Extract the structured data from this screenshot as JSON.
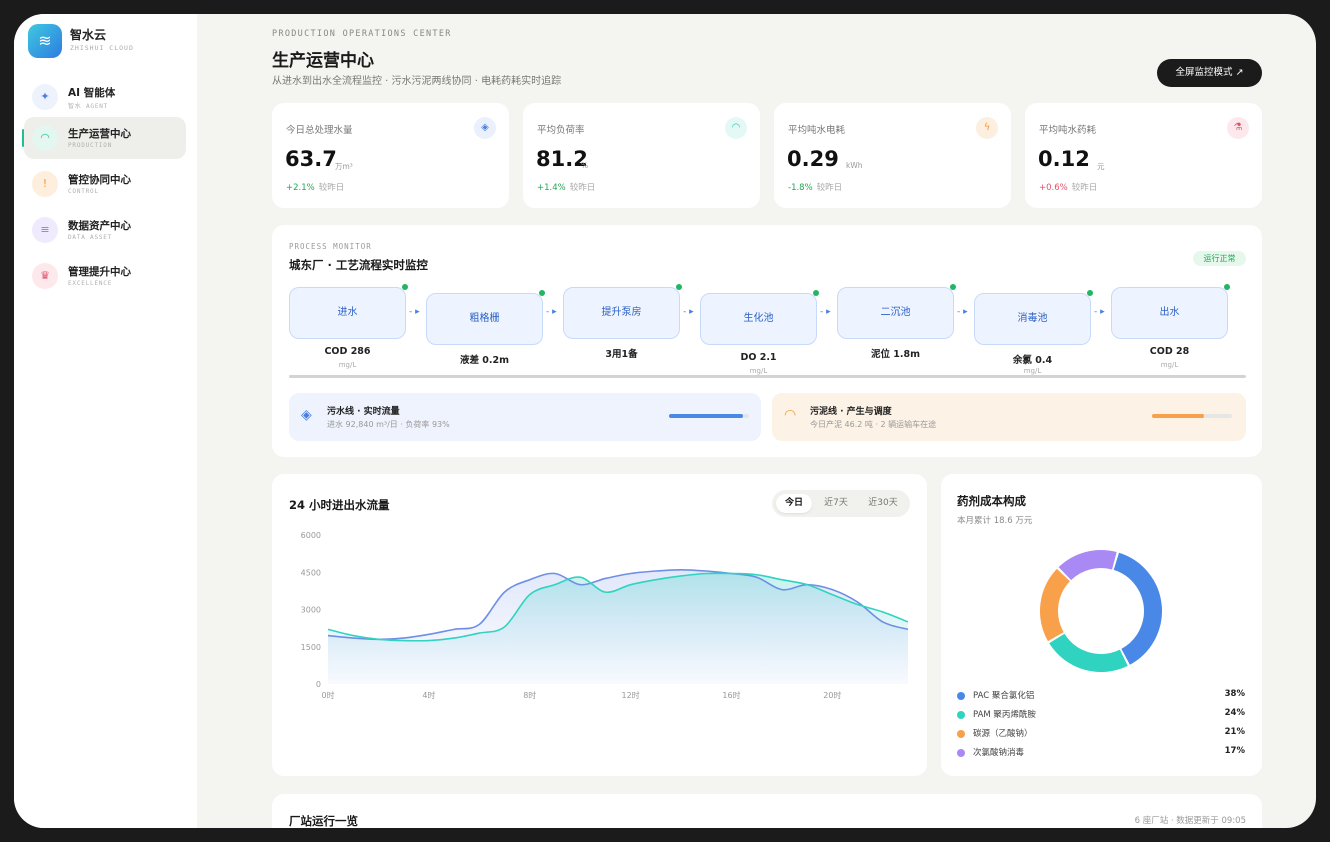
{
  "brand": {
    "name": "智水云",
    "sub": "ZHISHUI CLOUD"
  },
  "nav": [
    {
      "title": "AI 智能体",
      "sub": "智水 AGENT",
      "icon": "sparkle-icon",
      "glyph": "✦",
      "bg": "#eef2fd",
      "color": "#4a7fe0"
    },
    {
      "title": "生产运营中心",
      "sub": "PRODUCTION",
      "icon": "gauge-icon",
      "glyph": "◠",
      "bg": "#e4f6f0",
      "color": "#1fbf8f",
      "active": true
    },
    {
      "title": "管控协同中心",
      "sub": "CONTROL",
      "icon": "shield-icon",
      "glyph": "!",
      "bg": "#fdeedd",
      "color": "#f29a3d"
    },
    {
      "title": "数据资产中心",
      "sub": "DATA ASSET",
      "icon": "database-icon",
      "glyph": "≡",
      "bg": "#efeafd",
      "color": "#9b6ff0"
    },
    {
      "title": "管理提升中心",
      "sub": "EXCELLENCE",
      "icon": "trophy-icon",
      "glyph": "♛",
      "bg": "#fde8ec",
      "color": "#e4506a"
    }
  ],
  "header": {
    "overline": "PRODUCTION OPERATIONS CENTER",
    "title": "生产运营中心",
    "subtitle": "从进水到出水全流程监控 · 污水污泥两线协同 · 电耗药耗实时追踪",
    "fullscreen_label": "全屏监控模式 ↗"
  },
  "kpis": [
    {
      "label": "今日总处理水量",
      "value": "63.7",
      "unit": "万m³",
      "change": "+2.1%",
      "cmp": "较昨日",
      "change_color": "#1ea854",
      "icon": "droplet-icon",
      "glyph": "◈",
      "bg": "#eaf1fd",
      "color": "#4a7fe0"
    },
    {
      "label": "平均负荷率",
      "value": "81.2",
      "unit": "%",
      "change": "+1.4%",
      "cmp": "较昨日",
      "change_color": "#1ea854",
      "icon": "gauge-icon",
      "glyph": "◠",
      "bg": "#e4f8f6",
      "color": "#25c4b4"
    },
    {
      "label": "平均吨水电耗",
      "value": "0.29",
      "unit": "kWh",
      "change": "-1.8%",
      "cmp": "较昨日",
      "change_color": "#1ea854",
      "icon": "bolt-icon",
      "glyph": "ϟ",
      "bg": "#fdefe0",
      "color": "#f29a3d"
    },
    {
      "label": "平均吨水药耗",
      "value": "0.12",
      "unit": "元",
      "change": "+0.6%",
      "cmp": "较昨日",
      "change_color": "#e4506a",
      "icon": "flask-icon",
      "glyph": "⚗",
      "bg": "#fde9ec",
      "color": "#e4506a"
    }
  ],
  "process": {
    "overline": "PROCESS MONITOR",
    "title": "城东厂 · 工艺流程实时监控",
    "status": "运行正常",
    "stages": [
      {
        "name": "进水",
        "metric": "COD 286",
        "unit": "mg/L"
      },
      {
        "name": "粗格栅",
        "metric": "液差 0.2m",
        "unit": ""
      },
      {
        "name": "提升泵房",
        "metric": "3用1备",
        "unit": ""
      },
      {
        "name": "生化池",
        "metric": "DO 2.1",
        "unit": "mg/L"
      },
      {
        "name": "二沉池",
        "metric": "泥位 1.8m",
        "unit": ""
      },
      {
        "name": "消毒池",
        "metric": "余氯 0.4",
        "unit": "mg/L"
      },
      {
        "name": "出水",
        "metric": "COD 28",
        "unit": "mg/L"
      }
    ],
    "sewage_line": {
      "title": "污水线 · 实时流量",
      "sub": "进水 92,840 m³/日 · 负荷率 93%",
      "progress": 0.93,
      "icon": "droplet-icon"
    },
    "sludge_line": {
      "title": "污泥线 · 产生与调度",
      "sub": "今日产泥 46.2 吨 · 2 辆运输车在途",
      "progress": 0.65,
      "icon": "gauge-icon"
    }
  },
  "flow_card": {
    "title": "24 小时进出水流量",
    "tabs": [
      "今日",
      "近7天",
      "近30天"
    ],
    "active_tab": 0
  },
  "cost_card": {
    "title": "药剂成本构成",
    "subtitle": "本月累计 18.6 万元",
    "items": [
      {
        "label": "PAC 聚合氯化铝",
        "pct": "38%",
        "value": 38,
        "color": "#4a88e8"
      },
      {
        "label": "PAM 聚丙烯酰胺",
        "pct": "24%",
        "value": 24,
        "color": "#2fd3bf"
      },
      {
        "label": "碳源（乙酸钠）",
        "pct": "21%",
        "value": 21,
        "color": "#f8a04a"
      },
      {
        "label": "次氯酸钠消毒",
        "pct": "17%",
        "value": 17,
        "color": "#a98af5"
      }
    ]
  },
  "stations": {
    "title": "厂站运行一览",
    "meta": "6 座厂站 · 数据更新于 09:05"
  },
  "chart_data": {
    "type": "area",
    "title": "24 小时进出水流量",
    "xlabel": "",
    "ylabel": "",
    "xlim": [
      0,
      23
    ],
    "ylim": [
      0,
      6000
    ],
    "yticks": [
      0,
      1500,
      3000,
      4500,
      6000
    ],
    "xticks": [
      0,
      4,
      8,
      12,
      16,
      20
    ],
    "xtick_labels": [
      "0时",
      "4时",
      "8时",
      "12时",
      "16时",
      "20时"
    ],
    "grid": false,
    "series": [
      {
        "color": "#6f8fe6",
        "x": [
          0,
          1,
          2,
          3,
          4,
          5,
          6,
          7,
          8,
          9,
          10,
          11,
          12,
          13,
          14,
          15,
          16,
          17,
          18,
          19,
          20,
          21,
          22,
          23
        ],
        "values": [
          1950,
          1850,
          1800,
          1850,
          2000,
          2200,
          2400,
          3700,
          4200,
          4450,
          4000,
          4250,
          4450,
          4550,
          4600,
          4550,
          4450,
          4300,
          3800,
          4000,
          3800,
          3300,
          2500,
          2200
        ]
      },
      {
        "color": "#2fd3bf",
        "fill": true,
        "x": [
          0,
          1,
          2,
          3,
          4,
          5,
          6,
          7,
          8,
          9,
          10,
          11,
          12,
          13,
          14,
          15,
          16,
          17,
          18,
          19,
          20,
          21,
          22,
          23
        ],
        "values": [
          2200,
          1950,
          1800,
          1750,
          1750,
          1850,
          2050,
          2300,
          3600,
          4000,
          4300,
          3700,
          4000,
          4200,
          4350,
          4450,
          4450,
          4400,
          4200,
          4000,
          3600,
          3200,
          2900,
          2500
        ]
      }
    ]
  }
}
